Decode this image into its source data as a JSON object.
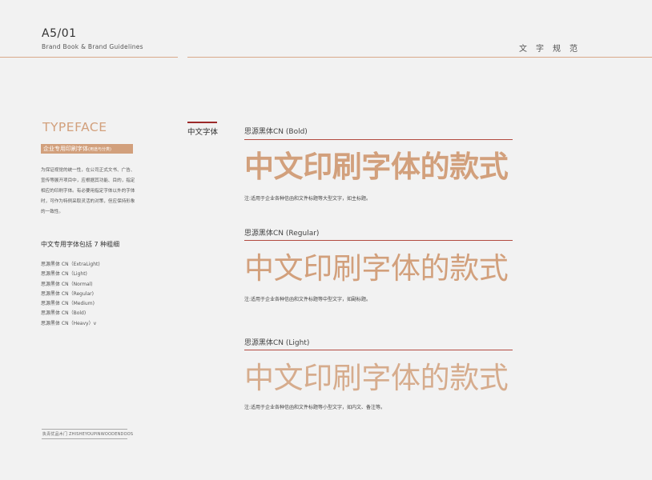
{
  "header": {
    "page_number": "A5/01",
    "brand_subtitle": "Brand Book & Brand Guidelines",
    "section_title": "文字规范"
  },
  "left": {
    "heading": "TYPEFACE",
    "label_main": "企业专用印刷字体",
    "label_small": "(用途与分类)",
    "intro": "为保证视觉的统一性，在公司正式文书、广告、宣传等展开项目中，应根据其功能、目的，指定相应的印刷字体。有必要用指定字体以外的字体时，可作为特例采取灵活的对策，但应保持形象的一致性。",
    "weights_title": "中文专用字体包括 7 种粗细",
    "weights": [
      "思源黑体 CN（ExtraLight)",
      "思源黑体 CN（Light)",
      "思源黑体 CN（Normal)",
      "思源黑体 CN（Regular)",
      "思源黑体 CN（Medium)",
      "思源黑体 CN（Bold)",
      "思源黑体 CN（Heavy）v"
    ],
    "footer": "执青优品木门 ZHISHEYOUPINWOODENDOOS"
  },
  "middle": {
    "label": "中文字体"
  },
  "samples": [
    {
      "name": "思源黑体CN (Bold)",
      "text": "中文印刷字体的款式",
      "note": "注:适用于企业各种信函和文件标题等大型文字，如主标题。"
    },
    {
      "name": "思源黑体CN (Regular)",
      "text": "中文印刷字体的款式",
      "note": "注:适用于企业各种信函和文件标题等中型文字，如副标题。"
    },
    {
      "name": "思源黑体CN (Light)",
      "text": "中文印刷字体的款式",
      "note": "注:适用于企业各种信函和文件标题等小型文字，如内文、备注等。"
    }
  ],
  "colors": {
    "accent": "#d2a07c",
    "rule_red": "#b34a40",
    "background": "#f2f2f2"
  }
}
